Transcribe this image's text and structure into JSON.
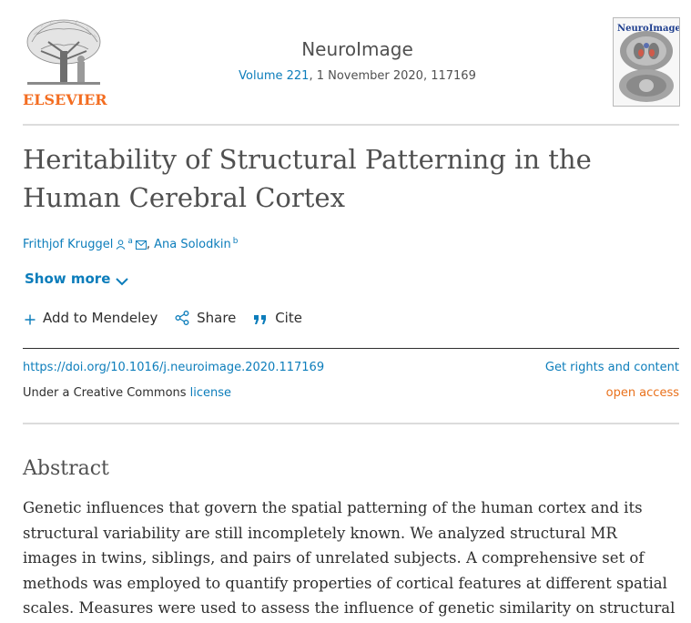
{
  "header": {
    "publisher": "ELSEVIER",
    "journal_title": "NeuroImage",
    "volume_link": "Volume 221",
    "issue_meta": ", 1 November 2020, 117169",
    "cover_title": "NeuroImage"
  },
  "article": {
    "title_line1": "Heritability of Structural Patterning in the",
    "title_line2": "Human Cerebral Cortex",
    "authors": [
      {
        "name": "Frithjof Kruggel",
        "sup": "a"
      },
      {
        "name": "Ana Solodkin",
        "sup": "b"
      }
    ],
    "author_separator": ","
  },
  "controls": {
    "show_more": "Show more",
    "add_to_mendeley": "Add to Mendeley",
    "share": "Share",
    "cite": "Cite"
  },
  "links": {
    "doi": "https://doi.org/10.1016/j.neuroimage.2020.117169",
    "rights": "Get rights and content",
    "license_prefix": "Under a Creative Commons ",
    "license_link": "license",
    "open_access": "open access"
  },
  "abstract": {
    "heading": "Abstract",
    "lines": [
      "Genetic influences that govern the spatial patterning of the human cortex and its",
      "structural variability are still incompletely known. We analyzed structural MR",
      "images in twins, siblings, and pairs of unrelated subjects. A comprehensive set of",
      "methods was employed to quantify properties of cortical features at different spatial",
      "scales. Measures were used to assess the influence of genetic similarity on structural"
    ]
  },
  "colors": {
    "link": "#0c7dbb",
    "brand_orange": "#f36d21",
    "open_access": "#e9711c",
    "text": "#2e2e2e"
  }
}
